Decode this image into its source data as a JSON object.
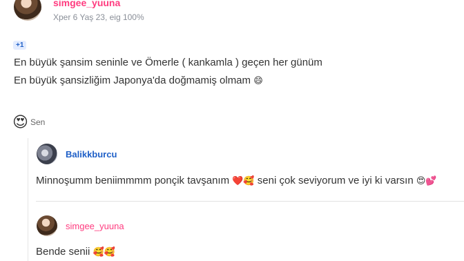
{
  "post": {
    "username": "simgee_yuuna",
    "meta": "Xper 6 Yaş 23, eig 100%",
    "badge": "+1",
    "line1": "En büyük şansim seninle ve Ömerle ( kankamla ) geçen her günüm",
    "line2": "En büyük şansizliğim Japonya'da doğmamiş olmam",
    "line2_emoji": "😄"
  },
  "reaction": {
    "emoji": "😍",
    "label": "Sen"
  },
  "replies": [
    {
      "username": "Balikkburcu",
      "text_part1": "Minnoşumm beniimmmm ponçik tavşanım ",
      "emoji1": "❤️🥰",
      "text_part2": " seni çok seviyorum ve iyi ki varsın ",
      "emoji2": "😍💕"
    },
    {
      "username": "simgee_yuuna",
      "text": "Bende senii ",
      "emoji": "🥰🥰"
    }
  ],
  "colors": {
    "pink": "#ff3b7f",
    "blue": "#1e5fc7"
  }
}
